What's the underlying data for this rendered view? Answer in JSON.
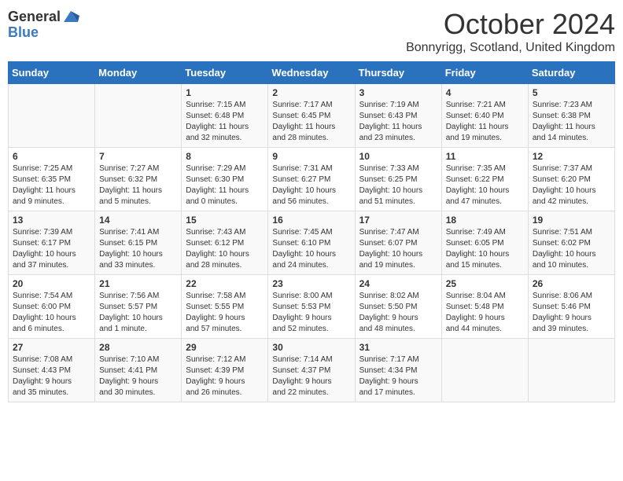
{
  "logo": {
    "general": "General",
    "blue": "Blue"
  },
  "title": "October 2024",
  "subtitle": "Bonnyrigg, Scotland, United Kingdom",
  "days_header": [
    "Sunday",
    "Monday",
    "Tuesday",
    "Wednesday",
    "Thursday",
    "Friday",
    "Saturday"
  ],
  "weeks": [
    [
      {
        "day": "",
        "info": ""
      },
      {
        "day": "",
        "info": ""
      },
      {
        "day": "1",
        "info": "Sunrise: 7:15 AM\nSunset: 6:48 PM\nDaylight: 11 hours\nand 32 minutes."
      },
      {
        "day": "2",
        "info": "Sunrise: 7:17 AM\nSunset: 6:45 PM\nDaylight: 11 hours\nand 28 minutes."
      },
      {
        "day": "3",
        "info": "Sunrise: 7:19 AM\nSunset: 6:43 PM\nDaylight: 11 hours\nand 23 minutes."
      },
      {
        "day": "4",
        "info": "Sunrise: 7:21 AM\nSunset: 6:40 PM\nDaylight: 11 hours\nand 19 minutes."
      },
      {
        "day": "5",
        "info": "Sunrise: 7:23 AM\nSunset: 6:38 PM\nDaylight: 11 hours\nand 14 minutes."
      }
    ],
    [
      {
        "day": "6",
        "info": "Sunrise: 7:25 AM\nSunset: 6:35 PM\nDaylight: 11 hours\nand 9 minutes."
      },
      {
        "day": "7",
        "info": "Sunrise: 7:27 AM\nSunset: 6:32 PM\nDaylight: 11 hours\nand 5 minutes."
      },
      {
        "day": "8",
        "info": "Sunrise: 7:29 AM\nSunset: 6:30 PM\nDaylight: 11 hours\nand 0 minutes."
      },
      {
        "day": "9",
        "info": "Sunrise: 7:31 AM\nSunset: 6:27 PM\nDaylight: 10 hours\nand 56 minutes."
      },
      {
        "day": "10",
        "info": "Sunrise: 7:33 AM\nSunset: 6:25 PM\nDaylight: 10 hours\nand 51 minutes."
      },
      {
        "day": "11",
        "info": "Sunrise: 7:35 AM\nSunset: 6:22 PM\nDaylight: 10 hours\nand 47 minutes."
      },
      {
        "day": "12",
        "info": "Sunrise: 7:37 AM\nSunset: 6:20 PM\nDaylight: 10 hours\nand 42 minutes."
      }
    ],
    [
      {
        "day": "13",
        "info": "Sunrise: 7:39 AM\nSunset: 6:17 PM\nDaylight: 10 hours\nand 37 minutes."
      },
      {
        "day": "14",
        "info": "Sunrise: 7:41 AM\nSunset: 6:15 PM\nDaylight: 10 hours\nand 33 minutes."
      },
      {
        "day": "15",
        "info": "Sunrise: 7:43 AM\nSunset: 6:12 PM\nDaylight: 10 hours\nand 28 minutes."
      },
      {
        "day": "16",
        "info": "Sunrise: 7:45 AM\nSunset: 6:10 PM\nDaylight: 10 hours\nand 24 minutes."
      },
      {
        "day": "17",
        "info": "Sunrise: 7:47 AM\nSunset: 6:07 PM\nDaylight: 10 hours\nand 19 minutes."
      },
      {
        "day": "18",
        "info": "Sunrise: 7:49 AM\nSunset: 6:05 PM\nDaylight: 10 hours\nand 15 minutes."
      },
      {
        "day": "19",
        "info": "Sunrise: 7:51 AM\nSunset: 6:02 PM\nDaylight: 10 hours\nand 10 minutes."
      }
    ],
    [
      {
        "day": "20",
        "info": "Sunrise: 7:54 AM\nSunset: 6:00 PM\nDaylight: 10 hours\nand 6 minutes."
      },
      {
        "day": "21",
        "info": "Sunrise: 7:56 AM\nSunset: 5:57 PM\nDaylight: 10 hours\nand 1 minute."
      },
      {
        "day": "22",
        "info": "Sunrise: 7:58 AM\nSunset: 5:55 PM\nDaylight: 9 hours\nand 57 minutes."
      },
      {
        "day": "23",
        "info": "Sunrise: 8:00 AM\nSunset: 5:53 PM\nDaylight: 9 hours\nand 52 minutes."
      },
      {
        "day": "24",
        "info": "Sunrise: 8:02 AM\nSunset: 5:50 PM\nDaylight: 9 hours\nand 48 minutes."
      },
      {
        "day": "25",
        "info": "Sunrise: 8:04 AM\nSunset: 5:48 PM\nDaylight: 9 hours\nand 44 minutes."
      },
      {
        "day": "26",
        "info": "Sunrise: 8:06 AM\nSunset: 5:46 PM\nDaylight: 9 hours\nand 39 minutes."
      }
    ],
    [
      {
        "day": "27",
        "info": "Sunrise: 7:08 AM\nSunset: 4:43 PM\nDaylight: 9 hours\nand 35 minutes."
      },
      {
        "day": "28",
        "info": "Sunrise: 7:10 AM\nSunset: 4:41 PM\nDaylight: 9 hours\nand 30 minutes."
      },
      {
        "day": "29",
        "info": "Sunrise: 7:12 AM\nSunset: 4:39 PM\nDaylight: 9 hours\nand 26 minutes."
      },
      {
        "day": "30",
        "info": "Sunrise: 7:14 AM\nSunset: 4:37 PM\nDaylight: 9 hours\nand 22 minutes."
      },
      {
        "day": "31",
        "info": "Sunrise: 7:17 AM\nSunset: 4:34 PM\nDaylight: 9 hours\nand 17 minutes."
      },
      {
        "day": "",
        "info": ""
      },
      {
        "day": "",
        "info": ""
      }
    ]
  ]
}
